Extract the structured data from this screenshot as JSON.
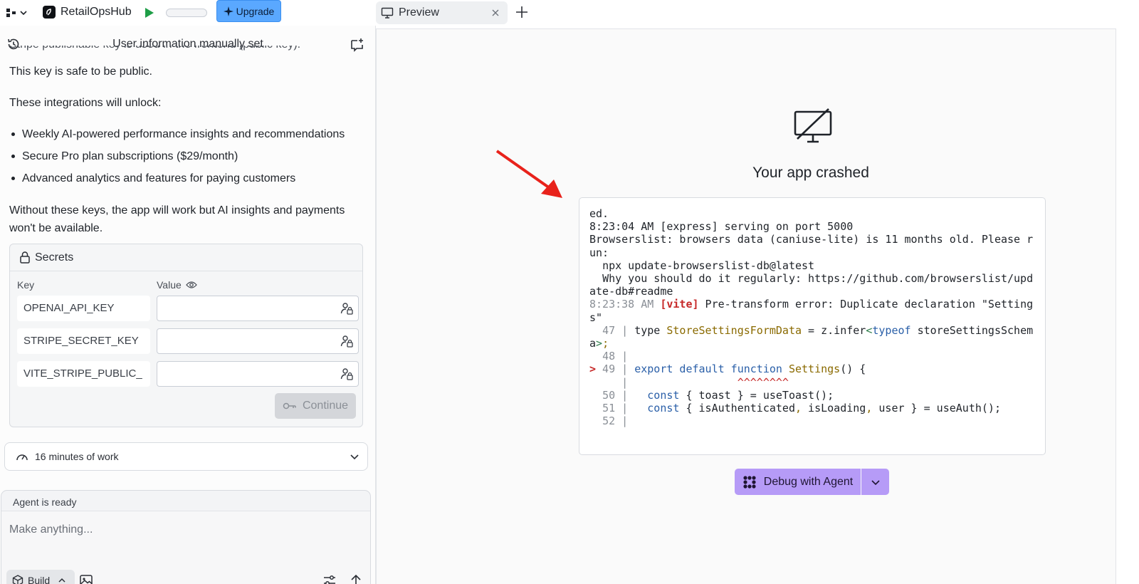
{
  "project": {
    "name": "RetailOpsHub",
    "upgrade_label": "Upgrade"
  },
  "panel": {
    "title": "User information manually set"
  },
  "message": {
    "partial_line": "Stripe publishable key is used in the frontend (public key).",
    "safe_note": "This key is safe to be public.",
    "intro": "These integrations will unlock:",
    "bullets": [
      "Weekly AI-powered performance insights and recommendations",
      "Secure Pro plan subscriptions ($29/month)",
      "Advanced analytics and features for paying customers"
    ],
    "outro": "Without these keys, the app will work but AI insights and payments won't be available."
  },
  "secrets": {
    "title": "Secrets",
    "key_header": "Key",
    "value_header": "Value",
    "rows": [
      {
        "key": "OPENAI_API_KEY",
        "value": ""
      },
      {
        "key": "STRIPE_SECRET_KEY",
        "value": ""
      },
      {
        "key": "VITE_STRIPE_PUBLIC_",
        "value": ""
      }
    ],
    "continue_label": "Continue"
  },
  "work": {
    "summary": "16 minutes of work"
  },
  "agent": {
    "status": "Agent is ready",
    "placeholder": "Make anything...",
    "mode_label": "Build"
  },
  "tabs": [
    {
      "label": "Preview"
    }
  ],
  "preview": {
    "crash_title": "Your app crashed",
    "debug_label": "Debug with Agent"
  },
  "colors": {
    "accent": "#5aa8ff",
    "debug": "#b69bf7",
    "error": "#c62828"
  },
  "icons": {
    "workspace": "workspace-icon",
    "run": "play-icon",
    "history": "history-icon",
    "new_chat": "new-chat-icon",
    "lock": "lock-icon",
    "eye": "eye-icon",
    "secret_value": "user-lock-icon",
    "key": "key-icon",
    "gauge": "gauge-icon",
    "chevron": "chevron-down-icon",
    "cube": "cube-icon",
    "image": "image-icon",
    "settings": "sliders-icon",
    "send": "arrow-up-icon",
    "monitor": "monitor-icon",
    "close": "close-icon",
    "plus": "plus-icon",
    "crashed": "monitor-off-icon",
    "agent": "agent-icon",
    "arrow": "red-arrow-icon"
  }
}
